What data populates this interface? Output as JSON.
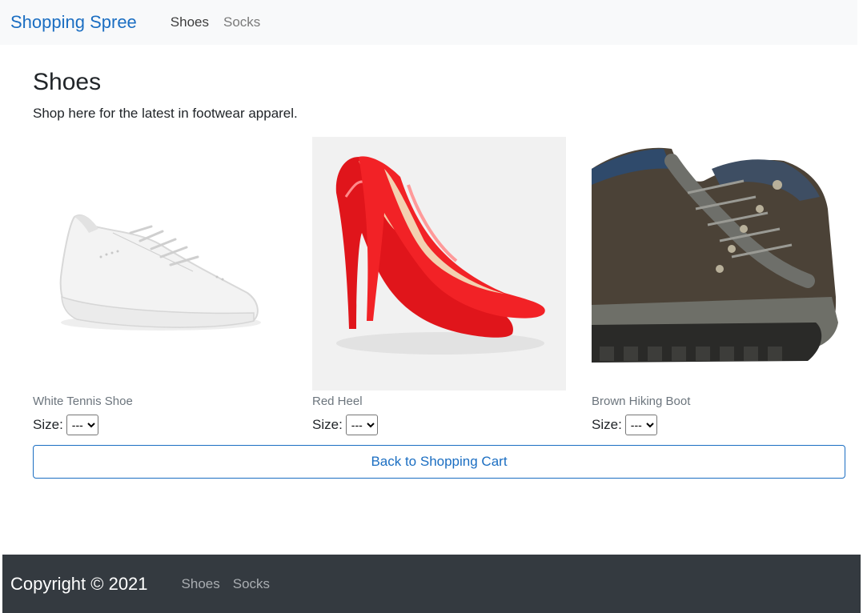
{
  "nav": {
    "brand": "Shopping Spree",
    "links": [
      {
        "label": "Shoes"
      },
      {
        "label": "Socks"
      }
    ]
  },
  "page": {
    "title": "Shoes",
    "subtitle": "Shop here for the latest in footwear apparel."
  },
  "products": [
    {
      "name": "White Tennis Shoe",
      "size_label": "Size:",
      "size_value": "---",
      "icon": "white-tennis-shoe-image"
    },
    {
      "name": "Red Heel",
      "size_label": "Size:",
      "size_value": "---",
      "icon": "red-heel-image"
    },
    {
      "name": "Brown Hiking Boot",
      "size_label": "Size:",
      "size_value": "---",
      "icon": "brown-hiking-boot-image"
    }
  ],
  "actions": {
    "back_label": "Back to Shopping Cart"
  },
  "footer": {
    "copyright": "Copyright © 2021",
    "links": [
      {
        "label": "Shoes"
      },
      {
        "label": "Socks"
      }
    ]
  },
  "colors": {
    "brand": "#1b6ec2",
    "navbar_bg": "#f8f9fa",
    "footer_bg": "#343a40",
    "muted_text": "#6c757d"
  }
}
